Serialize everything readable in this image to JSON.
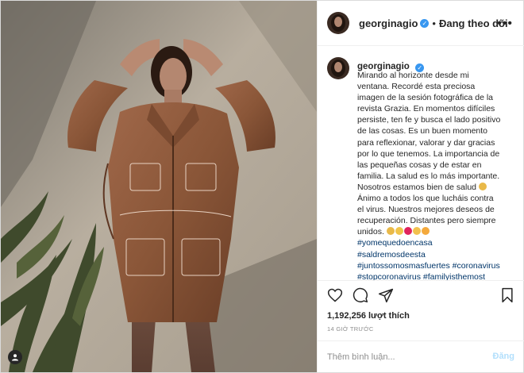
{
  "post": {
    "username": "georginagio",
    "follow_status": "Đang theo dõi",
    "separator": "•",
    "more_icon": "more-horizontal-icon",
    "caption": {
      "username": "georginagio",
      "lines": [
        "Mirando al horizonte desde mi",
        "ventana. Recordé esta preciosa",
        "imagen de la sesión fotográfica de la",
        "revista Grazia. En momentos difíciles",
        "persiste, ten fe y busca el lado positivo",
        "de las cosas. Es un buen momento",
        "para reflexionar, valorar y dar gracias",
        "por lo que tenemos. La importancia de",
        "las pequeñas cosas y de estar en",
        "familia. La salud es lo más importante.",
        "Nosotros estamos bien de salud",
        "Ánimo a todos los que lucháis contra",
        "el virus. Nuestros mejores deseos de",
        "recuperación. Distantes pero siempre",
        "unidos."
      ],
      "hashtags": [
        "#yomequedoencasa",
        "#saldremosdeesta",
        "#juntossomosmasfuertes #coronavirus",
        "#stopcoronavirus #familyisthemost"
      ]
    },
    "likes": "1,192,256 lượt thích",
    "time": "14 GIỜ TRƯỚC",
    "comment_placeholder": "Thêm bình luận...",
    "post_button": "Đăng"
  },
  "colors": {
    "link": "#003569",
    "verified": "#3897f0",
    "post_disabled": "#b2dffc",
    "muted": "#8e8e8e"
  }
}
